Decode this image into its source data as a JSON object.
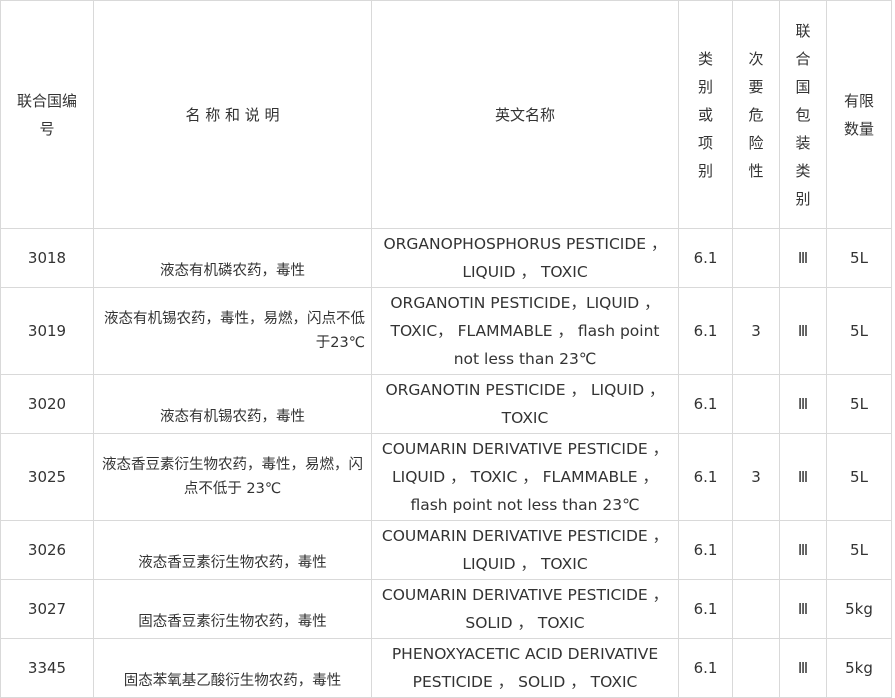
{
  "headers": {
    "un_no": "联合国编号",
    "name_desc": "名 称 和 说 明",
    "english_name": "英文名称",
    "class": "类别或项别",
    "subsidiary_risk": "次要危险性",
    "packing_group": "联合国包装类别",
    "limited_qty": "有限数量"
  },
  "rows": [
    {
      "un_no": "3018",
      "name_desc": "液态有机磷农药，毒性",
      "english": "ORGANOPHOSPHORUS PESTICIDE ， LIQUID ， TOXIC",
      "class": "6.1",
      "subsidiary_risk": "",
      "packing_group": "Ⅲ",
      "limited_qty": "5L"
    },
    {
      "un_no": "3019",
      "name_desc": "液态有机锡农药，毒性，易燃，闪点不低于23℃",
      "english": "ORGANOTIN PESTICIDE，LIQUID ，TOXIC， FLAMMABLE ， flash point not less than 23℃",
      "class": "6.1",
      "subsidiary_risk": "3",
      "packing_group": "Ⅲ",
      "limited_qty": "5L"
    },
    {
      "un_no": "3020",
      "name_desc": "液态有机锡农药，毒性",
      "english": "ORGANOTIN PESTICIDE ， LIQUID ， TOXIC",
      "class": "6.1",
      "subsidiary_risk": "",
      "packing_group": "Ⅲ",
      "limited_qty": "5L"
    },
    {
      "un_no": "3025",
      "name_desc": "液态香豆素衍生物农药，毒性，易燃，闪点不低于 23℃",
      "english": "COUMARIN DERIVATIVE PESTICIDE ， LIQUID ， TOXIC ， FLAMMABLE ， flash point not less than 23℃",
      "class": "6.1",
      "subsidiary_risk": "3",
      "packing_group": "Ⅲ",
      "limited_qty": "5L"
    },
    {
      "un_no": "3026",
      "name_desc": "液态香豆素衍生物农药，毒性",
      "english": "COUMARIN DERIVATIVE PESTICIDE ， LIQUID ， TOXIC",
      "class": "6.1",
      "subsidiary_risk": "",
      "packing_group": "Ⅲ",
      "limited_qty": "5L"
    },
    {
      "un_no": "3027",
      "name_desc": "固态香豆素衍生物农药，毒性",
      "english": "COUMARIN DERIVATIVE PESTICIDE ， SOLID ， TOXIC",
      "class": "6.1",
      "subsidiary_risk": "",
      "packing_group": "Ⅲ",
      "limited_qty": "5kg"
    },
    {
      "un_no": "3345",
      "name_desc": "固态苯氧基乙酸衍生物农药，毒性",
      "english": "PHENOXYACETIC ACID DERIVATIVE PESTICIDE ， SOLID ， TOXIC",
      "class": "6.1",
      "subsidiary_risk": "",
      "packing_group": "Ⅲ",
      "limited_qty": "5kg"
    }
  ]
}
